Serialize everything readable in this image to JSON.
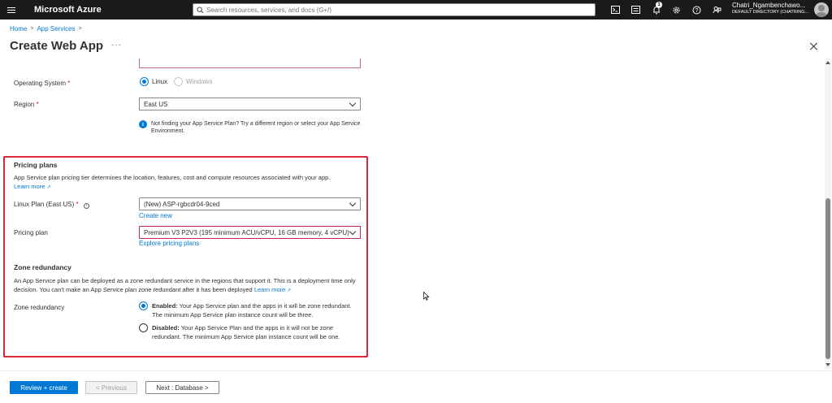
{
  "topbar": {
    "brand": "Microsoft Azure",
    "search_placeholder": "Search resources, services, and docs (G+/)",
    "notification_count": "1",
    "user_name": "Chatri_Ngambenchawo...",
    "directory": "DEFAULT DIRECTORY (CHATRING..."
  },
  "breadcrumb": {
    "home": "Home",
    "app_services": "App Services"
  },
  "page": {
    "title": "Create Web App",
    "more": "···"
  },
  "form": {
    "os_label": "Operating System",
    "os_options": [
      "Linux",
      "Windows"
    ],
    "os_selected": "Linux",
    "region_label": "Region",
    "region_value": "East US",
    "region_note": "Not finding your App Service Plan? Try a different region or select your App Service Environment."
  },
  "pricing": {
    "title": "Pricing plans",
    "description": "App Service plan pricing tier determines the location, features, cost and compute resources associated with your app.",
    "learn_more": "Learn more",
    "linux_plan_label": "Linux Plan (East US)",
    "linux_plan_value": "(New) ASP-rgbcdr04-9ced",
    "create_new": "Create new",
    "pricing_plan_label": "Pricing plan",
    "pricing_plan_value": "Premium V3 P2V3 (195 minimum ACU/vCPU, 16 GB memory, 4 vCPU)",
    "explore_link": "Explore pricing plans"
  },
  "zone": {
    "title": "Zone redundancy",
    "description": "An App Service plan can be deployed as a zone redundant service in the regions that support it. This is a deployment time only decision. You can't make an App Service plan zone redundant after it has been deployed",
    "learn_more": "Learn more",
    "label": "Zone redundancy",
    "enabled_title": "Enabled:",
    "enabled_text": "Your App Service plan and the apps in it will be zone redundant. The minimum App Service plan instance count will be three.",
    "disabled_title": "Disabled:",
    "disabled_text": "Your App Service Plan and the apps in it will not be zone redundant. The minimum App Service plan instance count will be one.",
    "selected": "Enabled"
  },
  "footer": {
    "review_create": "Review + create",
    "previous": "< Previous",
    "next": "Next : Database >"
  },
  "colors": {
    "accent": "#0078d4",
    "highlight_border": "#d9283a",
    "topbar": "#1b1a19"
  }
}
